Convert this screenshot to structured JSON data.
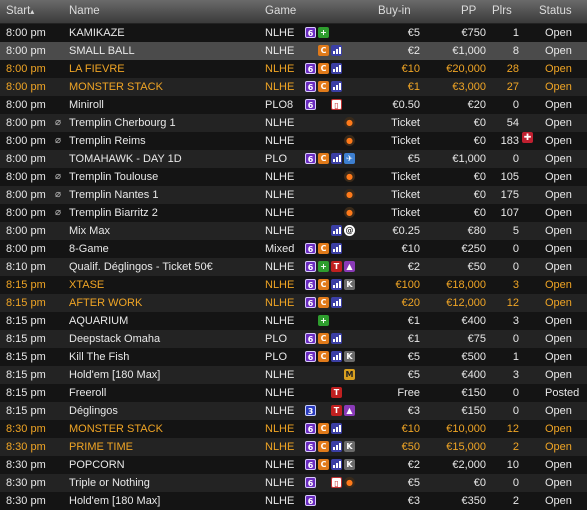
{
  "header": {
    "start": "Start",
    "sort_glyph": "▴",
    "name": "Name",
    "game": "Game",
    "buyin": "Buy-in",
    "pp": "PP",
    "plrs": "Plrs",
    "status": "Status"
  },
  "colors": {
    "highlight": "#f0a525",
    "text": "#e8e8e8"
  },
  "rows": [
    {
      "start": "8:00 pm",
      "name": "KAMIKAZE",
      "game": "NLHE",
      "icons": [
        "six-icon",
        "plus-icon"
      ],
      "buyin": "€5",
      "pp": "€750",
      "plrs": "1",
      "status": "Open"
    },
    {
      "start": "8:00 pm",
      "name": "SMALL BALL",
      "game": "NLHE",
      "icons": [
        "cash-icon",
        "bars-icon"
      ],
      "buyin": "€2",
      "pp": "€1,000",
      "plrs": "8",
      "status": "Open",
      "selected": true
    },
    {
      "start": "8:00 pm",
      "name": "LA FIEVRE",
      "game": "NLHE",
      "icons": [
        "six-icon",
        "cash-icon",
        "bars-icon"
      ],
      "buyin": "€10",
      "pp": "€20,000",
      "plrs": "28",
      "status": "Open",
      "highlight": true
    },
    {
      "start": "8:00 pm",
      "name": "MONSTER STACK",
      "game": "NLHE",
      "icons": [
        "six-icon",
        "cash-icon",
        "bars-icon"
      ],
      "buyin": "€1",
      "pp": "€3,000",
      "plrs": "27",
      "status": "Open",
      "highlight": true
    },
    {
      "start": "8:00 pm",
      "name": "Miniroll",
      "game": "PLO8",
      "icons": [
        "six-icon",
        "box-icon"
      ],
      "buyin": "€0.50",
      "pp": "€20",
      "plrs": "0",
      "status": "Open"
    },
    {
      "start": "8:00 pm",
      "name": "Tremplin Cherbourg 1",
      "game": "NLHE",
      "icons": [
        "bomb-icon"
      ],
      "buyin": "Ticket",
      "pp": "€0",
      "plrs": "54",
      "status": "Open",
      "ticket": true
    },
    {
      "start": "8:00 pm",
      "name": "Tremplin Reims",
      "game": "NLHE",
      "icons": [
        "bomb-icon"
      ],
      "buyin": "Ticket",
      "pp": "€0",
      "plrs": "183",
      "status": "Open",
      "ticket": true,
      "flag": "✚"
    },
    {
      "start": "8:00 pm",
      "name": "TOMAHAWK - DAY 1D",
      "game": "PLO",
      "icons": [
        "six-icon",
        "cash-icon",
        "bars-icon",
        "plane-icon"
      ],
      "buyin": "€5",
      "pp": "€1,000",
      "plrs": "0",
      "status": "Open"
    },
    {
      "start": "8:00 pm",
      "name": "Tremplin Toulouse",
      "game": "NLHE",
      "icons": [
        "bomb-icon"
      ],
      "buyin": "Ticket",
      "pp": "€0",
      "plrs": "105",
      "status": "Open",
      "ticket": true
    },
    {
      "start": "8:00 pm",
      "name": "Tremplin Nantes 1",
      "game": "NLHE",
      "icons": [
        "bomb-icon"
      ],
      "buyin": "Ticket",
      "pp": "€0",
      "plrs": "175",
      "status": "Open",
      "ticket": true
    },
    {
      "start": "8:00 pm",
      "name": "Tremplin Biarritz 2",
      "game": "NLHE",
      "icons": [
        "bomb-icon"
      ],
      "buyin": "Ticket",
      "pp": "€0",
      "plrs": "107",
      "status": "Open",
      "ticket": true
    },
    {
      "start": "8:00 pm",
      "name": "Mix Max",
      "game": "NLHE",
      "icons": [
        "bars-icon",
        "spiral-icon"
      ],
      "buyin": "€0.25",
      "pp": "€80",
      "plrs": "5",
      "status": "Open"
    },
    {
      "start": "8:00 pm",
      "name": "8-Game",
      "game": "Mixed",
      "icons": [
        "six-icon",
        "cash-icon",
        "bars-icon"
      ],
      "buyin": "€10",
      "pp": "€250",
      "plrs": "0",
      "status": "Open"
    },
    {
      "start": "8:10 pm",
      "name": "Qualif. Déglingos - Ticket 50€",
      "game": "NLHE",
      "icons": [
        "six-icon",
        "plus-icon",
        "t-icon",
        "triangle-icon"
      ],
      "buyin": "€2",
      "pp": "€50",
      "plrs": "0",
      "status": "Open"
    },
    {
      "start": "8:15 pm",
      "name": "XTASE",
      "game": "NLHE",
      "icons": [
        "six-icon",
        "cash-icon",
        "bars-icon",
        "k-icon"
      ],
      "buyin": "€100",
      "pp": "€18,000",
      "plrs": "3",
      "status": "Open",
      "highlight": true
    },
    {
      "start": "8:15 pm",
      "name": "AFTER WORK",
      "game": "NLHE",
      "icons": [
        "six-icon",
        "cash-icon",
        "bars-icon"
      ],
      "buyin": "€20",
      "pp": "€12,000",
      "plrs": "12",
      "status": "Open",
      "highlight": true
    },
    {
      "start": "8:15 pm",
      "name": "AQUARIUM",
      "game": "NLHE",
      "icons": [
        "plus-icon"
      ],
      "buyin": "€1",
      "pp": "€400",
      "plrs": "3",
      "status": "Open"
    },
    {
      "start": "8:15 pm",
      "name": "Deepstack Omaha",
      "game": "PLO",
      "icons": [
        "six-icon",
        "cash-icon",
        "bars-icon"
      ],
      "buyin": "€1",
      "pp": "€75",
      "plrs": "0",
      "status": "Open"
    },
    {
      "start": "8:15 pm",
      "name": "Kill The Fish",
      "game": "PLO",
      "icons": [
        "six-icon",
        "cash-icon",
        "bars-icon",
        "k-icon"
      ],
      "buyin": "€5",
      "pp": "€500",
      "plrs": "1",
      "status": "Open"
    },
    {
      "start": "8:15 pm",
      "name": "Hold'em [180 Max]",
      "game": "NLHE",
      "icons": [
        "m-icon"
      ],
      "buyin": "€5",
      "pp": "€400",
      "plrs": "3",
      "status": "Open"
    },
    {
      "start": "8:15 pm",
      "name": "Freeroll",
      "game": "NLHE",
      "icons": [
        "t-icon"
      ],
      "buyin": "Free",
      "pp": "€150",
      "plrs": "0",
      "status": "Posted"
    },
    {
      "start": "8:15 pm",
      "name": "Déglingos",
      "game": "NLHE",
      "icons": [
        "three-icon",
        "t-icon",
        "triangle-icon"
      ],
      "buyin": "€3",
      "pp": "€150",
      "plrs": "0",
      "status": "Open"
    },
    {
      "start": "8:30 pm",
      "name": "MONSTER STACK",
      "game": "NLHE",
      "icons": [
        "six-icon",
        "cash-icon",
        "bars-icon"
      ],
      "buyin": "€10",
      "pp": "€10,000",
      "plrs": "12",
      "status": "Open",
      "highlight": true
    },
    {
      "start": "8:30 pm",
      "name": "PRIME TIME",
      "game": "NLHE",
      "icons": [
        "six-icon",
        "cash-icon",
        "bars-icon",
        "k-icon"
      ],
      "buyin": "€50",
      "pp": "€15,000",
      "plrs": "2",
      "status": "Open",
      "highlight": true
    },
    {
      "start": "8:30 pm",
      "name": "POPCORN",
      "game": "NLHE",
      "icons": [
        "six-icon",
        "cash-icon",
        "bars-icon",
        "k-icon"
      ],
      "buyin": "€2",
      "pp": "€2,000",
      "plrs": "10",
      "status": "Open"
    },
    {
      "start": "8:30 pm",
      "name": "Triple or Nothing",
      "game": "NLHE",
      "icons": [
        "six-icon",
        "box-icon",
        "bomb-icon"
      ],
      "buyin": "€5",
      "pp": "€0",
      "plrs": "0",
      "status": "Open"
    },
    {
      "start": "8:30 pm",
      "name": "Hold'em [180 Max]",
      "game": "NLHE",
      "icons": [
        "six-icon"
      ],
      "buyin": "€3",
      "pp": "€350",
      "plrs": "2",
      "status": "Open"
    }
  ]
}
